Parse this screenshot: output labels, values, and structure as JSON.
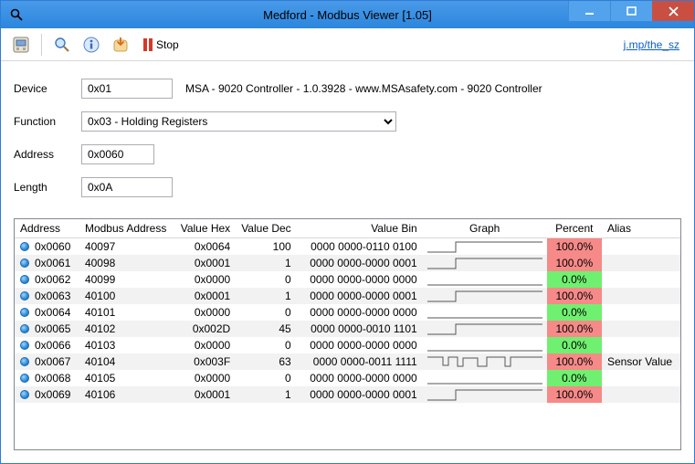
{
  "window": {
    "title": "Medford - Modbus Viewer [1.05]"
  },
  "toolbar": {
    "stop_label": "Stop",
    "link_text": "j.mp/the_sz"
  },
  "form": {
    "device_label": "Device",
    "device_value": "0x01",
    "device_desc": "MSA - 9020 Controller - 1.0.3928 - www.MSAsafety.com - 9020 Controller",
    "function_label": "Function",
    "function_value": "0x03 - Holding Registers",
    "address_label": "Address",
    "address_value": "0x0060",
    "length_label": "Length",
    "length_value": "0x0A"
  },
  "grid": {
    "headers": {
      "address": "Address",
      "maddress": "Modbus Address",
      "hex": "Value Hex",
      "dec": "Value Dec",
      "bin": "Value Bin",
      "graph": "Graph",
      "percent": "Percent",
      "alias": "Alias"
    },
    "rows": [
      {
        "address": "0x0060",
        "maddress": "40097",
        "hex": "0x0064",
        "dec": "100",
        "bin": "0000 0000-0110 0100",
        "graph": "step",
        "percent": "100.0%",
        "pclass": "hi",
        "alias": ""
      },
      {
        "address": "0x0061",
        "maddress": "40098",
        "hex": "0x0001",
        "dec": "1",
        "bin": "0000 0000-0000 0001",
        "graph": "step",
        "percent": "100.0%",
        "pclass": "hi",
        "alias": ""
      },
      {
        "address": "0x0062",
        "maddress": "40099",
        "hex": "0x0000",
        "dec": "0",
        "bin": "0000 0000-0000 0000",
        "graph": "flat",
        "percent": "0.0%",
        "pclass": "lo",
        "alias": ""
      },
      {
        "address": "0x0063",
        "maddress": "40100",
        "hex": "0x0001",
        "dec": "1",
        "bin": "0000 0000-0000 0001",
        "graph": "step",
        "percent": "100.0%",
        "pclass": "hi",
        "alias": ""
      },
      {
        "address": "0x0064",
        "maddress": "40101",
        "hex": "0x0000",
        "dec": "0",
        "bin": "0000 0000-0000 0000",
        "graph": "flat",
        "percent": "0.0%",
        "pclass": "lo",
        "alias": ""
      },
      {
        "address": "0x0065",
        "maddress": "40102",
        "hex": "0x002D",
        "dec": "45",
        "bin": "0000 0000-0010 1101",
        "graph": "step",
        "percent": "100.0%",
        "pclass": "hi",
        "alias": ""
      },
      {
        "address": "0x0066",
        "maddress": "40103",
        "hex": "0x0000",
        "dec": "0",
        "bin": "0000 0000-0000 0000",
        "graph": "flat",
        "percent": "0.0%",
        "pclass": "lo",
        "alias": ""
      },
      {
        "address": "0x0067",
        "maddress": "40104",
        "hex": "0x003F",
        "dec": "63",
        "bin": "0000 0000-0011 1111",
        "graph": "noisy",
        "percent": "100.0%",
        "pclass": "hi",
        "alias": "Sensor Value"
      },
      {
        "address": "0x0068",
        "maddress": "40105",
        "hex": "0x0000",
        "dec": "0",
        "bin": "0000 0000-0000 0000",
        "graph": "flat",
        "percent": "0.0%",
        "pclass": "lo",
        "alias": ""
      },
      {
        "address": "0x0069",
        "maddress": "40106",
        "hex": "0x0001",
        "dec": "1",
        "bin": "0000 0000-0000 0001",
        "graph": "step",
        "percent": "100.0%",
        "pclass": "hi",
        "alias": ""
      }
    ]
  }
}
